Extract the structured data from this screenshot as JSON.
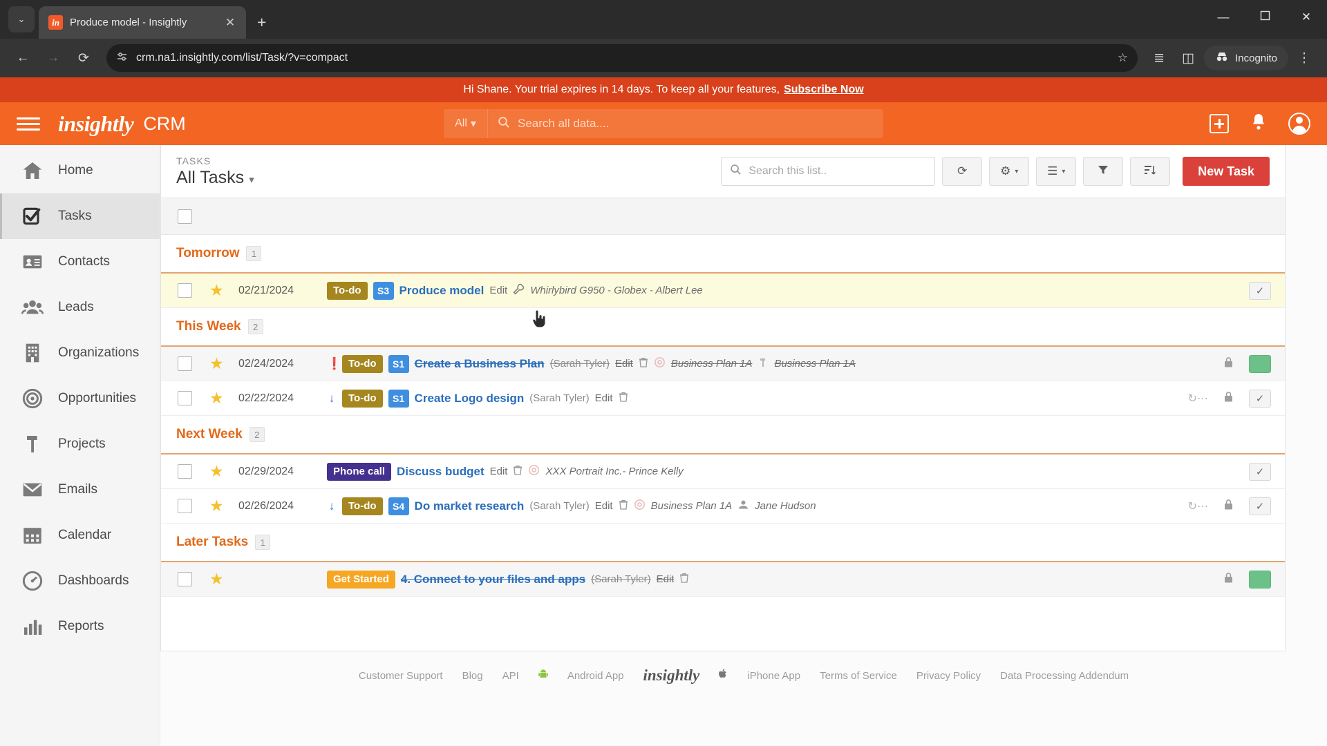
{
  "browser": {
    "tab_title": "Produce model - Insightly",
    "favicon_letters": "in",
    "new_tab_label": "+",
    "close_label": "✕",
    "tab_list_label": "⌄",
    "url": "crm.na1.insightly.com/list/Task/?v=compact",
    "back_icon": "←",
    "forward_icon": "→",
    "reload_icon": "⟳",
    "site_info_icon": "site-settings-icon",
    "bookmark_icon": "☆",
    "split_icon": "◫",
    "reading_list_icon": "≣",
    "incognito_label": "Incognito",
    "menu_icon": "⋮",
    "minimize": "—",
    "maximize": "⬜",
    "close_window": "✕"
  },
  "trial": {
    "message": "Hi Shane. Your trial expires in 14 days. To keep all your features,",
    "cta": "Subscribe Now"
  },
  "topbar": {
    "logo": "insightly",
    "product": "CRM",
    "search_scope": "All",
    "search_placeholder": "Search all data....",
    "add_icon": "add-icon",
    "bell_icon": "notifications-icon",
    "account_icon": "account-icon"
  },
  "sidebar": {
    "items": [
      {
        "label": "Home",
        "icon": "home-icon",
        "active": false
      },
      {
        "label": "Tasks",
        "icon": "tasks-icon",
        "active": true
      },
      {
        "label": "Contacts",
        "icon": "contacts-icon",
        "active": false
      },
      {
        "label": "Leads",
        "icon": "leads-icon",
        "active": false
      },
      {
        "label": "Organizations",
        "icon": "organizations-icon",
        "active": false
      },
      {
        "label": "Opportunities",
        "icon": "opportunities-icon",
        "active": false
      },
      {
        "label": "Projects",
        "icon": "projects-icon",
        "active": false
      },
      {
        "label": "Emails",
        "icon": "emails-icon",
        "active": false
      },
      {
        "label": "Calendar",
        "icon": "calendar-icon",
        "active": false
      },
      {
        "label": "Dashboards",
        "icon": "dashboards-icon",
        "active": false
      },
      {
        "label": "Reports",
        "icon": "reports-icon",
        "active": false
      }
    ]
  },
  "list_header": {
    "kicker": "TASKS",
    "title": "All Tasks",
    "title_caret": "▾",
    "search_placeholder": "Search this list..",
    "refresh_icon": "⟳",
    "settings_icon": "⚙",
    "columns_icon": "☰",
    "filter_icon": "▽",
    "sort_icon": "sort-icon",
    "new_task_label": "New Task"
  },
  "groups": [
    {
      "name": "Tomorrow",
      "count": "1",
      "tasks": [
        {
          "date": "02/21/2024",
          "priority": "",
          "badge": "To-do",
          "badge_type": "todo",
          "stage": "S3",
          "name": "Produce model",
          "owner": "",
          "edit": "Edit",
          "delete_icon": "Ὕ1",
          "link_icon": "opportunity-icon",
          "link": "Whirlybird G950 - Globex - Albert Lee",
          "second_link": "",
          "second_link_icon": "",
          "recurring": false,
          "locked": false,
          "completed": false,
          "highlight": true
        }
      ]
    },
    {
      "name": "This Week",
      "count": "2",
      "tasks": [
        {
          "date": "02/24/2024",
          "priority": "high",
          "badge": "To-do",
          "badge_type": "todo",
          "stage": "S1",
          "name": "Create a Business Plan",
          "owner": "(Sarah Tyler)",
          "edit": "Edit",
          "delete_icon": "Ὕ1",
          "link_icon": "opportunity-icon",
          "link": "Business Plan 1A",
          "second_link_icon": "project-icon",
          "second_link": "Business Plan 1A",
          "recurring": false,
          "locked": true,
          "completed": true,
          "highlight": false
        },
        {
          "date": "02/22/2024",
          "priority": "low",
          "badge": "To-do",
          "badge_type": "todo",
          "stage": "S1",
          "name": "Create Logo design",
          "owner": "(Sarah Tyler)",
          "edit": "Edit",
          "delete_icon": "Ὕ1",
          "link_icon": "",
          "link": "",
          "second_link_icon": "",
          "second_link": "",
          "recurring": true,
          "locked": true,
          "completed": false,
          "highlight": false
        }
      ]
    },
    {
      "name": "Next Week",
      "count": "2",
      "tasks": [
        {
          "date": "02/29/2024",
          "priority": "",
          "badge": "Phone call",
          "badge_type": "phone",
          "stage": "",
          "name": "Discuss budget",
          "owner": "",
          "edit": "Edit",
          "delete_icon": "Ὕ1",
          "link_icon": "opportunity-icon",
          "link": "XXX Portrait Inc.- Prince Kelly",
          "second_link_icon": "",
          "second_link": "",
          "recurring": false,
          "locked": false,
          "completed": false,
          "highlight": false
        },
        {
          "date": "02/26/2024",
          "priority": "low",
          "badge": "To-do",
          "badge_type": "todo",
          "stage": "S4",
          "name": "Do market research",
          "owner": "(Sarah Tyler)",
          "edit": "Edit",
          "delete_icon": "Ὕ1",
          "link_icon": "opportunity-icon",
          "link": "Business Plan 1A",
          "second_link_icon": "contact-icon",
          "second_link": "Jane Hudson",
          "recurring": true,
          "locked": true,
          "completed": false,
          "highlight": false
        }
      ]
    },
    {
      "name": "Later Tasks",
      "count": "1",
      "tasks": [
        {
          "date": "",
          "priority": "",
          "badge": "Get Started",
          "badge_type": "getstarted",
          "stage": "",
          "name": "4. Connect to your files and apps",
          "owner": "(Sarah Tyler)",
          "edit": "Edit",
          "delete_icon": "Ὕ1",
          "link_icon": "",
          "link": "",
          "second_link_icon": "",
          "second_link": "",
          "recurring": false,
          "locked": true,
          "completed": true,
          "highlight": false
        }
      ]
    }
  ],
  "footer": {
    "links_left": [
      "Customer Support",
      "Blog",
      "API"
    ],
    "android": "Android App",
    "logo": "insightly",
    "iphone": "iPhone App",
    "links_right": [
      "Terms of Service",
      "Privacy Policy",
      "Data Processing Addendum"
    ]
  },
  "colors": {
    "brand_orange": "#f26522",
    "banner_orange": "#d8411b",
    "new_task_red": "#d9413a",
    "group_heading": "#e2691a",
    "link_blue": "#2a6ebb",
    "done_green": "#6bc187"
  }
}
